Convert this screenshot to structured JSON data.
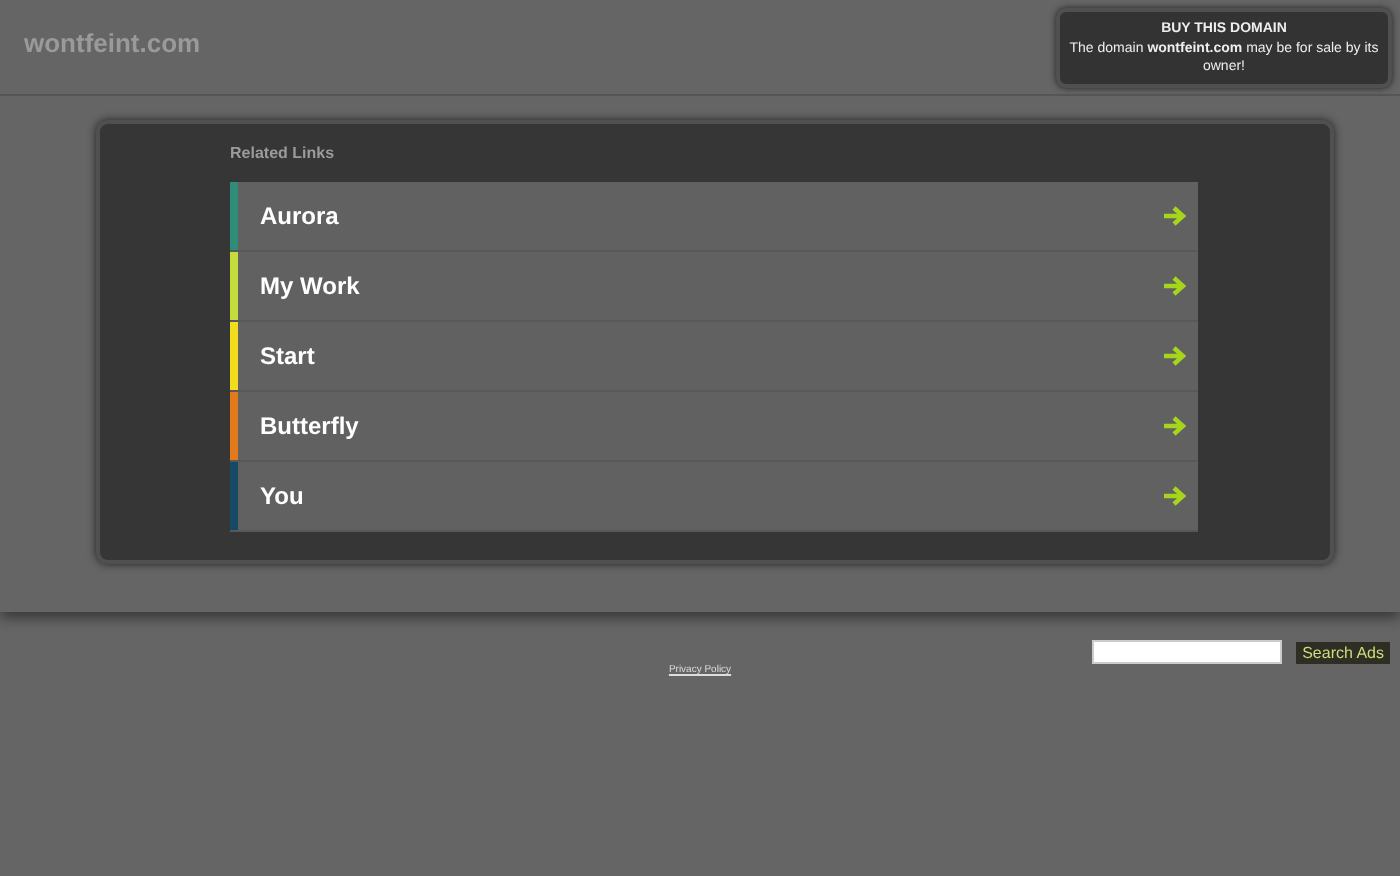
{
  "header": {
    "site_name": "wontfeint.com",
    "offer": {
      "title": "BUY THIS DOMAIN",
      "text": "The domain **wontfeint.com** may be for sale by its owner!"
    }
  },
  "related_links": {
    "heading": "Related Links",
    "items": [
      {
        "label": "Aurora",
        "color": "#2e8c78"
      },
      {
        "label": "My Work",
        "color": "#c6dc3c"
      },
      {
        "label": "Start",
        "color": "#f2dc1e"
      },
      {
        "label": "Butterfly",
        "color": "#e27a1c"
      },
      {
        "label": "You",
        "color": "#164a62"
      }
    ]
  },
  "footer": {
    "search_button": "Search Ads",
    "privacy_link": "Privacy Policy"
  }
}
